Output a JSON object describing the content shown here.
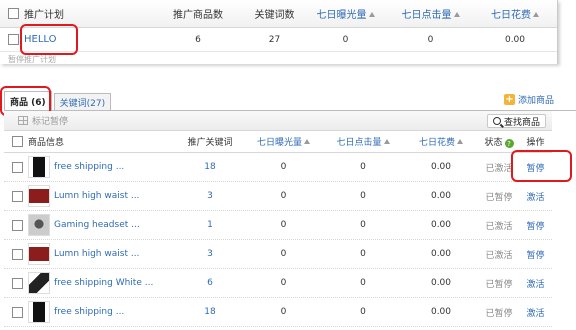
{
  "plans": {
    "headers": {
      "plan": "推广计划",
      "product_count": "推广商品数",
      "keyword_count": "关键词数",
      "impressions": "七日曝光量",
      "clicks": "七日点击量",
      "spend": "七日花费"
    },
    "row": {
      "name": "HELLO",
      "product_count": "6",
      "keyword_count": "27",
      "impressions": "0",
      "clicks": "0",
      "spend": "0.00"
    },
    "faded_text": "暂停推广计划"
  },
  "tabs": [
    {
      "label": "商品 (6)"
    },
    {
      "label": "关键词(27)"
    }
  ],
  "add_product_label": "添加商品",
  "toolbar": {
    "mark_pause_label": "标记暂停",
    "find_product_label": "查找商品"
  },
  "products": {
    "headers": {
      "info": "商品信息",
      "keywords": "推广关键词",
      "impressions": "七日曝光量",
      "clicks": "七日点击量",
      "spend": "七日花费",
      "status": "状态",
      "action": "操作"
    },
    "rows": [
      {
        "name": "free shipping ...",
        "keywords": "18",
        "impressions": "0",
        "clicks": "0",
        "spend": "0.00",
        "status": "已激活",
        "action": "暂停",
        "thumb": "dress"
      },
      {
        "name": "Lumn high waist ...",
        "keywords": "3",
        "impressions": "0",
        "clicks": "0",
        "spend": "0.00",
        "status": "已暂停",
        "action": "激活",
        "thumb": "skirt"
      },
      {
        "name": "Gaming headset ...",
        "keywords": "1",
        "impressions": "0",
        "clicks": "0",
        "spend": "0.00",
        "status": "已激活",
        "action": "暂停",
        "thumb": "headset"
      },
      {
        "name": "Lumn high waist ...",
        "keywords": "3",
        "impressions": "0",
        "clicks": "0",
        "spend": "0.00",
        "status": "已激活",
        "action": "暂停",
        "thumb": "skirt"
      },
      {
        "name": "free shipping White ...",
        "keywords": "6",
        "impressions": "0",
        "clicks": "0",
        "spend": "0.00",
        "status": "已暂停",
        "action": "激活",
        "thumb": "shoes"
      },
      {
        "name": "free shipping ...",
        "keywords": "18",
        "impressions": "0",
        "clicks": "0",
        "spend": "0.00",
        "status": "已暂停",
        "action": "激活",
        "thumb": "dress"
      }
    ]
  },
  "colors": {
    "link": "#2f6bb8",
    "highlight": "#e0191f"
  }
}
